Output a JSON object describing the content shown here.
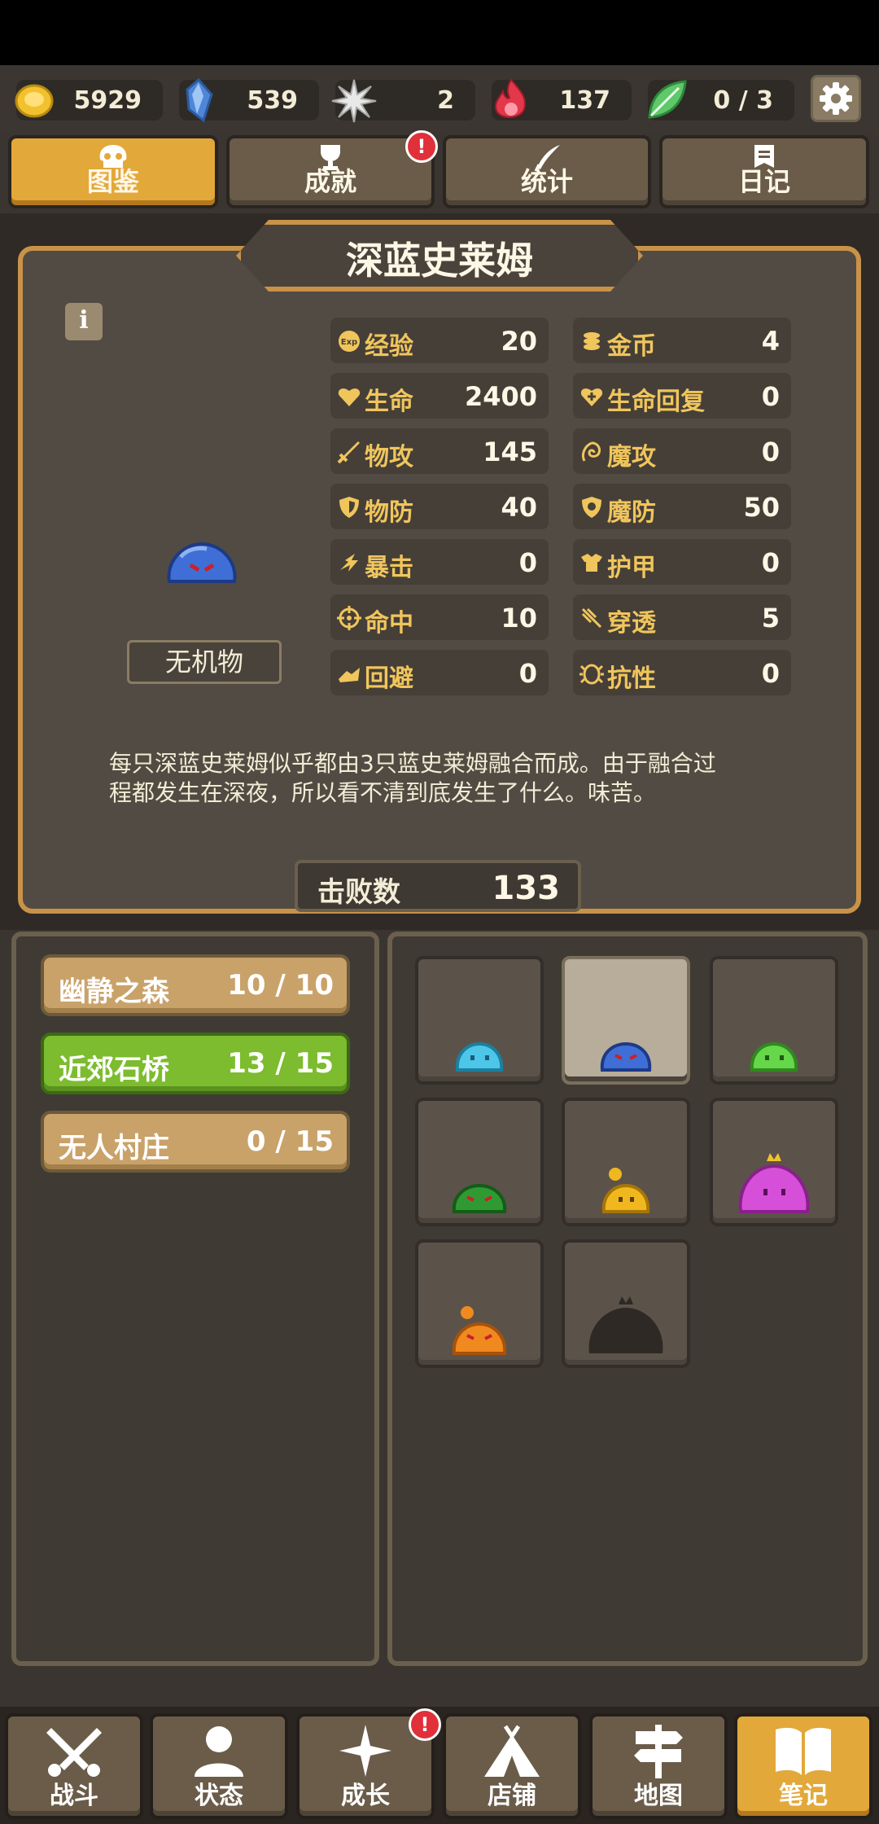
{
  "currencies": [
    {
      "name": "gold-coin-icon",
      "value": "5929",
      "color": "#f2c12e"
    },
    {
      "name": "blue-crystal-icon",
      "value": "539",
      "color": "#4f86d8"
    },
    {
      "name": "star-shard-icon",
      "value": "2",
      "color": "#d8d8d8"
    },
    {
      "name": "red-flame-icon",
      "value": "137",
      "color": "#e2384a"
    },
    {
      "name": "green-leaf-icon",
      "value": "0 / 3",
      "color": "#5ec86a"
    }
  ],
  "tabs": [
    {
      "label": "图鉴",
      "icon": "skull-icon",
      "active": true
    },
    {
      "label": "成就",
      "icon": "trophy-icon",
      "badge": "!"
    },
    {
      "label": "统计",
      "icon": "quill-icon"
    },
    {
      "label": "日记",
      "icon": "diary-icon"
    }
  ],
  "monster": {
    "name": "深蓝史莱姆",
    "type": "无机物",
    "info_label": "i",
    "description_line1": "每只深蓝史莱姆似乎都由3只蓝史莱姆融合而成。由于融合过",
    "description_line2": "程都发生在深夜，所以看不清到底发生了什么。味苦。",
    "defeat_label": "击败数",
    "defeat_count": "133"
  },
  "stats_left": [
    {
      "label": "经验",
      "value": "20",
      "icon": "exp-icon"
    },
    {
      "label": "生命",
      "value": "2400",
      "icon": "heart-icon"
    },
    {
      "label": "物攻",
      "value": "145",
      "icon": "sword-icon"
    },
    {
      "label": "物防",
      "value": "40",
      "icon": "shield-icon"
    },
    {
      "label": "暴击",
      "value": "0",
      "icon": "critical-icon"
    },
    {
      "label": "命中",
      "value": "10",
      "icon": "crosshair-icon"
    },
    {
      "label": "回避",
      "value": "0",
      "icon": "dodge-icon"
    }
  ],
  "stats_right": [
    {
      "label": "金币",
      "value": "4",
      "icon": "coins-icon"
    },
    {
      "label": "生命回复",
      "value": "0",
      "icon": "heart-plus-icon"
    },
    {
      "label": "魔攻",
      "value": "0",
      "icon": "magic-attack-icon"
    },
    {
      "label": "魔防",
      "value": "50",
      "icon": "magic-shield-icon"
    },
    {
      "label": "护甲",
      "value": "0",
      "icon": "armor-icon"
    },
    {
      "label": "穿透",
      "value": "5",
      "icon": "pierce-icon"
    },
    {
      "label": "抗性",
      "value": "0",
      "icon": "resist-icon"
    }
  ],
  "areas": [
    {
      "name": "幽静之森",
      "progress": "10 / 10"
    },
    {
      "name": "近郊石桥",
      "progress": "13 / 15",
      "active": true
    },
    {
      "name": "无人村庄",
      "progress": "0 / 15"
    }
  ],
  "bestiary": [
    {
      "icon": "light-blue-slime-icon"
    },
    {
      "icon": "dark-blue-slime-icon",
      "selected": true
    },
    {
      "icon": "green-slime-icon"
    },
    {
      "icon": "dark-green-slime-icon"
    },
    {
      "icon": "yellow-slime-icon"
    },
    {
      "icon": "purple-king-slime-icon"
    },
    {
      "icon": "orange-slime-icon"
    },
    {
      "icon": "unknown-king-slime-silhouette-icon"
    }
  ],
  "nav": [
    {
      "label": "战斗",
      "icon": "crossed-swords-icon"
    },
    {
      "label": "状态",
      "icon": "person-icon"
    },
    {
      "label": "成长",
      "icon": "sparkle-icon",
      "badge": "!"
    },
    {
      "label": "店铺",
      "icon": "tent-icon"
    },
    {
      "label": "地图",
      "icon": "signpost-icon"
    },
    {
      "label": "笔记",
      "icon": "open-book-icon",
      "active": true
    }
  ]
}
